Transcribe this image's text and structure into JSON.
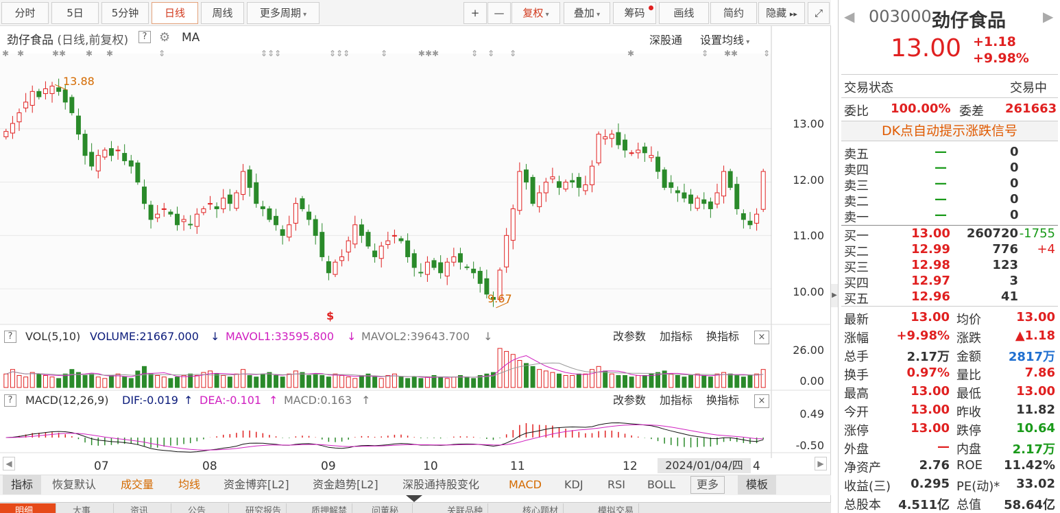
{
  "toolbar": {
    "tabs": [
      "分时",
      "5日",
      "5分钟",
      "日线",
      "周线",
      "更多周期"
    ],
    "active": "日线",
    "tools": [
      "+",
      "—",
      "复权",
      "叠加",
      "筹码",
      "画线",
      "简约",
      "隐藏"
    ]
  },
  "chart_header": {
    "name": "劲仔食品",
    "desc": "(日线,前复权)",
    "help": "?",
    "ma": "MA",
    "sgt": "深股通",
    "setma": "设置均线"
  },
  "price_axis": [
    "13.00",
    "12.00",
    "11.00",
    "10.00"
  ],
  "annotations": {
    "high": "13.88",
    "low": "9.67",
    "s_marker": "$"
  },
  "vol_panel": {
    "help": "?",
    "name": "VOL(5,10)",
    "volume": "VOLUME:21667.000",
    "mavol1": "MAVOL1:33595.800",
    "mavol2": "MAVOL2:39643.700",
    "axis": [
      "26.00",
      "0.00"
    ],
    "btn1": "改参数",
    "btn2": "加指标",
    "btn3": "换指标",
    "close": "×"
  },
  "macd_panel": {
    "help": "?",
    "name": "MACD(12,26,9)",
    "dif": "DIF:-0.019",
    "dea": "DEA:-0.101",
    "macd": "MACD:0.163",
    "axis": [
      "0.49",
      "-0.50"
    ],
    "btn1": "改参数",
    "btn2": "加指标",
    "btn3": "换指标",
    "close": "×"
  },
  "x_axis": [
    "07",
    "08",
    "09",
    "10",
    "11",
    "12"
  ],
  "date_box": "2024/01/04/四",
  "date_suffix": "4",
  "bottom_bar": [
    "指标",
    "恢复默认",
    "成交量",
    "均线",
    "资金博弈[L2]",
    "资金趋势[L2]",
    "深股通持股变化",
    "MACD",
    "KDJ",
    "RSI",
    "BOLL",
    "更多",
    "模板"
  ],
  "tabs": [
    "明细",
    "大事",
    "资讯",
    "公告",
    "研究报告",
    "质押解禁",
    "问董秘",
    "关联品种",
    "核心题材",
    "模拟交易"
  ],
  "quote": {
    "code": "003000",
    "name": "劲仔食品",
    "price": "13.00",
    "change": "+1.18",
    "pct": "+9.98%",
    "status_label": "交易状态",
    "status": "交易中",
    "weibi_label": "委比",
    "weibi": "100.00%",
    "weicha_label": "委差",
    "weicha": "261663",
    "dk": "DK点自动提示涨跌信号"
  },
  "asks": [
    {
      "label": "卖五",
      "price": "—",
      "vol": "0"
    },
    {
      "label": "卖四",
      "price": "—",
      "vol": "0"
    },
    {
      "label": "卖三",
      "price": "—",
      "vol": "0"
    },
    {
      "label": "卖二",
      "price": "—",
      "vol": "0"
    },
    {
      "label": "卖一",
      "price": "—",
      "vol": "0"
    }
  ],
  "bids": [
    {
      "label": "买一",
      "price": "13.00",
      "vol": "260720",
      "chg": "-1755"
    },
    {
      "label": "买二",
      "price": "12.99",
      "vol": "776",
      "chg": "+4"
    },
    {
      "label": "买三",
      "price": "12.98",
      "vol": "123",
      "chg": ""
    },
    {
      "label": "买四",
      "price": "12.97",
      "vol": "3",
      "chg": ""
    },
    {
      "label": "买五",
      "price": "12.96",
      "vol": "41",
      "chg": ""
    }
  ],
  "stats": [
    {
      "l1": "最新",
      "v1": "13.00",
      "l2": "均价",
      "v2": "13.00"
    },
    {
      "l1": "涨幅",
      "v1": "+9.98%",
      "l2": "涨跌",
      "v2": "▲1.18"
    },
    {
      "l1": "总手",
      "v1": "2.17万",
      "l2": "金额",
      "v2": "2817万"
    },
    {
      "l1": "换手",
      "v1": "0.97%",
      "l2": "量比",
      "v2": "7.86"
    },
    {
      "l1": "最高",
      "v1": "13.00",
      "l2": "最低",
      "v2": "13.00"
    },
    {
      "l1": "今开",
      "v1": "13.00",
      "l2": "昨收",
      "v2": "11.82"
    },
    {
      "l1": "涨停",
      "v1": "13.00",
      "l2": "跌停",
      "v2": "10.64"
    },
    {
      "l1": "外盘",
      "v1": "—",
      "l2": "内盘",
      "v2": "2.17万"
    },
    {
      "l1": "净资产",
      "v1": "2.76",
      "l2": "ROE",
      "v2": "11.42%"
    },
    {
      "l1": "收益(三)",
      "v1": "0.295",
      "l2": "PE(动)*",
      "v2": "33.02"
    },
    {
      "l1": "总股本",
      "v1": "4.511亿",
      "l2": "总值",
      "v2": "58.64亿"
    }
  ],
  "chart_data": {
    "type": "candlestick",
    "ylim": [
      9.5,
      14.0
    ],
    "highlights": {
      "high": 13.88,
      "low": 9.67
    },
    "close": [
      12.95,
      13.1,
      13.3,
      13.5,
      13.7,
      13.6,
      13.75,
      13.8,
      13.7,
      13.5,
      13.3,
      12.9,
      12.5,
      12.3,
      12.5,
      12.6,
      12.5,
      12.6,
      12.4,
      12.3,
      12.0,
      11.6,
      11.3,
      11.4,
      11.5,
      11.4,
      11.2,
      11.3,
      11.2,
      11.4,
      11.5,
      11.6,
      11.5,
      11.7,
      11.6,
      11.8,
      12.2,
      11.9,
      11.6,
      11.5,
      11.3,
      11.2,
      11.0,
      11.2,
      11.6,
      11.5,
      11.3,
      11.0,
      10.6,
      10.3,
      10.5,
      10.6,
      10.9,
      11.2,
      11.0,
      10.8,
      10.6,
      10.8,
      10.9,
      11.0,
      10.9,
      10.6,
      10.4,
      10.3,
      10.5,
      10.4,
      10.3,
      10.5,
      10.6,
      10.5,
      10.4,
      10.3,
      10.1,
      9.9,
      9.8,
      10.35,
      11.0,
      11.5,
      12.2,
      12.0,
      11.6,
      11.8,
      12.0,
      12.1,
      11.9,
      12.0,
      12.0,
      11.9,
      11.95,
      12.3,
      12.9,
      12.85,
      12.9,
      12.7,
      12.6,
      12.55,
      12.6,
      12.55,
      12.5,
      12.2,
      11.9,
      11.9,
      11.8,
      11.7,
      11.6,
      11.7,
      11.6,
      11.5,
      11.8,
      12.2,
      11.9,
      11.5,
      11.3,
      11.2,
      11.4,
      12.2
    ],
    "volume": [
      9,
      12,
      8,
      7,
      10,
      9,
      8,
      7,
      6,
      9,
      12,
      10,
      8,
      9,
      7,
      6,
      8,
      9,
      7,
      6,
      11,
      14,
      9,
      8,
      7,
      6,
      7,
      8,
      9,
      8,
      10,
      11,
      9,
      8,
      7,
      9,
      12,
      8,
      7,
      9,
      10,
      8,
      7,
      9,
      11,
      10,
      8,
      9,
      8,
      7,
      9,
      8,
      7,
      6,
      8,
      9,
      7,
      6,
      8,
      9,
      7,
      6,
      7,
      6,
      7,
      8,
      7,
      6,
      7,
      8,
      7,
      6,
      8,
      9,
      10,
      26,
      24,
      22,
      18,
      16,
      14,
      12,
      11,
      10,
      9,
      8,
      8,
      9,
      9,
      12,
      14,
      11,
      9,
      8,
      8,
      7,
      8,
      8,
      9,
      10,
      11,
      9,
      8,
      7,
      8,
      9,
      8,
      7,
      9,
      10,
      9,
      8,
      7,
      8,
      9,
      12
    ]
  }
}
